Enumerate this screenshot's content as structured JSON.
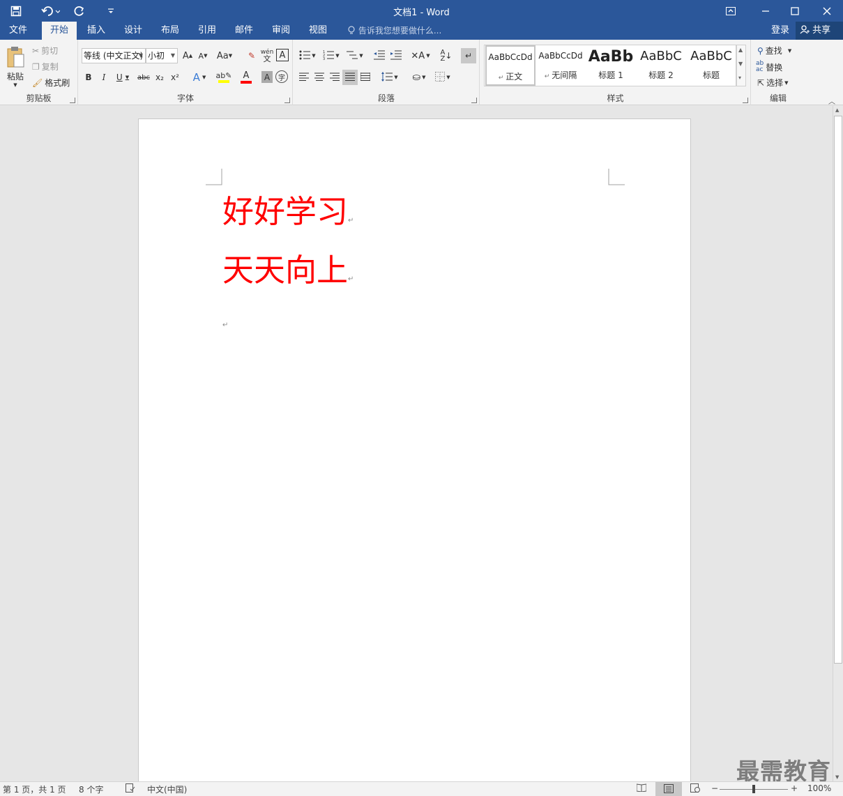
{
  "window": {
    "title": "文档1 - Word"
  },
  "qat": {
    "save": "save-icon",
    "undo": "undo-icon",
    "redo": "redo-icon",
    "customize": "customize-icon"
  },
  "tabs": [
    "文件",
    "开始",
    "插入",
    "设计",
    "布局",
    "引用",
    "邮件",
    "审阅",
    "视图"
  ],
  "tell_me": "告诉我您想要做什么...",
  "account": {
    "login": "登录",
    "share": "共享"
  },
  "ribbon": {
    "clipboard": {
      "label": "剪贴板",
      "paste": "粘贴",
      "cut": "剪切",
      "copy": "复制",
      "format_painter": "格式刷"
    },
    "font": {
      "label": "字体",
      "font_name": "等线 (中文正文)",
      "font_size": "小初",
      "bold": "B",
      "italic": "I",
      "underline": "U",
      "strike": "abc",
      "sub": "x₂",
      "sup": "x²",
      "grow": "A",
      "shrink": "A",
      "change_case": "Aa",
      "phonetic": "wén",
      "enclosed": "A",
      "font_color": "A",
      "shading": "A",
      "circle": "字"
    },
    "paragraph": {
      "label": "段落"
    },
    "styles": {
      "label": "样式",
      "items": [
        {
          "sample": "AaBbCcDd",
          "name": "正文"
        },
        {
          "sample": "AaBbCcDd",
          "name": "无间隔"
        },
        {
          "sample": "AaBb",
          "name": "标题 1"
        },
        {
          "sample": "AaBbC",
          "name": "标题 2"
        },
        {
          "sample": "AaBbC",
          "name": "标题"
        }
      ]
    },
    "editing": {
      "label": "编辑",
      "find": "查找",
      "replace": "替换",
      "select": "选择"
    }
  },
  "document": {
    "paragraphs": [
      "好好学习",
      "天天向上"
    ],
    "text_color": "#ff0000",
    "para_mark": "↵"
  },
  "status": {
    "page": "第 1 页，共 1 页",
    "words": "8 个字",
    "lang": "中文(中国)",
    "zoom": "100%",
    "zoom_level": 1.0
  },
  "watermark": "最需教育",
  "colors": {
    "accent": "#2b579a",
    "highlight": "#ffff00",
    "font_color_bar": "#ff0000"
  }
}
